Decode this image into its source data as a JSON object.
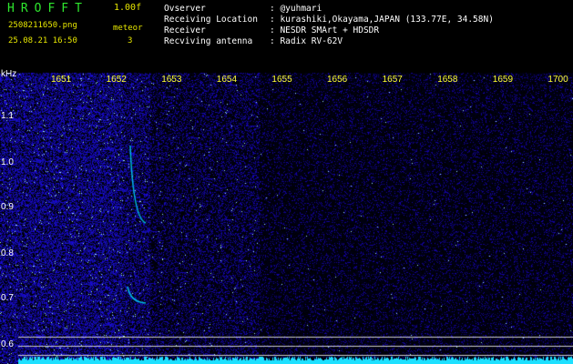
{
  "header": {
    "app_name": "HROFFT",
    "version": "1.00f",
    "filename": "2508211650.png",
    "mode": "meteor",
    "datetime": "25.08.21 16:50",
    "count": "3"
  },
  "info": {
    "observer": {
      "key": "Ovserver",
      "value": ": @yuhmari"
    },
    "location": {
      "key": "Receiving Location",
      "value": ": kurashiki,Okayama,JAPAN (133.77E, 34.58N)"
    },
    "receiver": {
      "key": "Receiver",
      "value": ": NESDR SMArt + HDSDR"
    },
    "antenna": {
      "key": "Recviving antenna",
      "value": ": Radix RV-62V"
    }
  },
  "axis": {
    "y_unit": "kHz",
    "time_ticks": [
      "1651",
      "1652",
      "1653",
      "1654",
      "1655",
      "1656",
      "1657",
      "1658",
      "1659",
      "1700"
    ],
    "freq_ticks": [
      "1.1",
      "1.0",
      "0.9",
      "0.8",
      "0.7",
      "0.6"
    ]
  },
  "chart_data": {
    "type": "heatmap",
    "x": [
      "1651",
      "1652",
      "1653",
      "1654",
      "1655",
      "1656",
      "1657",
      "1658",
      "1659",
      "1700"
    ],
    "y": [
      "1.1",
      "1.0",
      "0.9",
      "0.8",
      "0.7",
      "0.6"
    ],
    "xlabel": "",
    "ylabel": "kHz",
    "colors": {
      "background": "#000000",
      "noise": "#1a2fd0",
      "signal": "#00ffff",
      "axis_text": "#ffff33"
    }
  }
}
